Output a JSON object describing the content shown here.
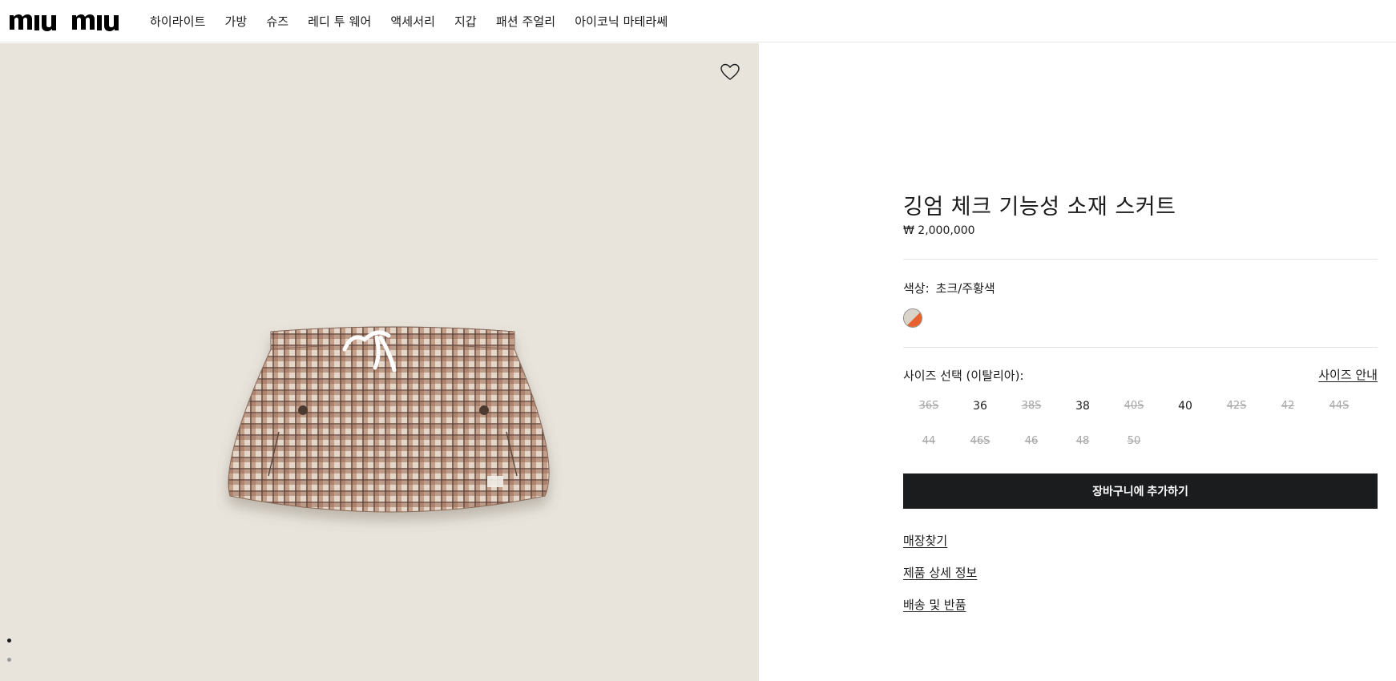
{
  "brand": {
    "logo_text": "miu miu"
  },
  "nav": {
    "items": [
      {
        "label": "하이라이트"
      },
      {
        "label": "가방"
      },
      {
        "label": "슈즈"
      },
      {
        "label": "레디 투 웨어"
      },
      {
        "label": "액세서리"
      },
      {
        "label": "지갑"
      },
      {
        "label": "패션 주얼리"
      },
      {
        "label": "아이코닉 마테라쎄"
      }
    ]
  },
  "product": {
    "title": "깅엄 체크 기능성 소재 스커트",
    "price": "₩ 2,000,000",
    "color_label": "색상:",
    "color_value": "초크/주황색",
    "swatch_colors": [
      "#d9d3c9",
      "#e8602c"
    ],
    "size_label": "사이즈 선택 (이탈리아):",
    "size_guide": "사이즈 안내",
    "sizes": [
      {
        "label": "36S",
        "available": false
      },
      {
        "label": "36",
        "available": true
      },
      {
        "label": "38S",
        "available": false
      },
      {
        "label": "38",
        "available": true
      },
      {
        "label": "40S",
        "available": false
      },
      {
        "label": "40",
        "available": true
      },
      {
        "label": "42S",
        "available": false
      },
      {
        "label": "42",
        "available": false
      },
      {
        "label": "44S",
        "available": false
      },
      {
        "label": "44",
        "available": false
      },
      {
        "label": "46S",
        "available": false
      },
      {
        "label": "46",
        "available": false
      },
      {
        "label": "48",
        "available": false
      },
      {
        "label": "50",
        "available": false
      }
    ],
    "add_to_cart": "장바구니에 추가하기",
    "links": {
      "store_finder": "매장찾기",
      "details": "제품 상세 정보",
      "shipping": "배송 및 반품"
    }
  },
  "gallery": {
    "image_count": 2,
    "active_index": 0
  }
}
